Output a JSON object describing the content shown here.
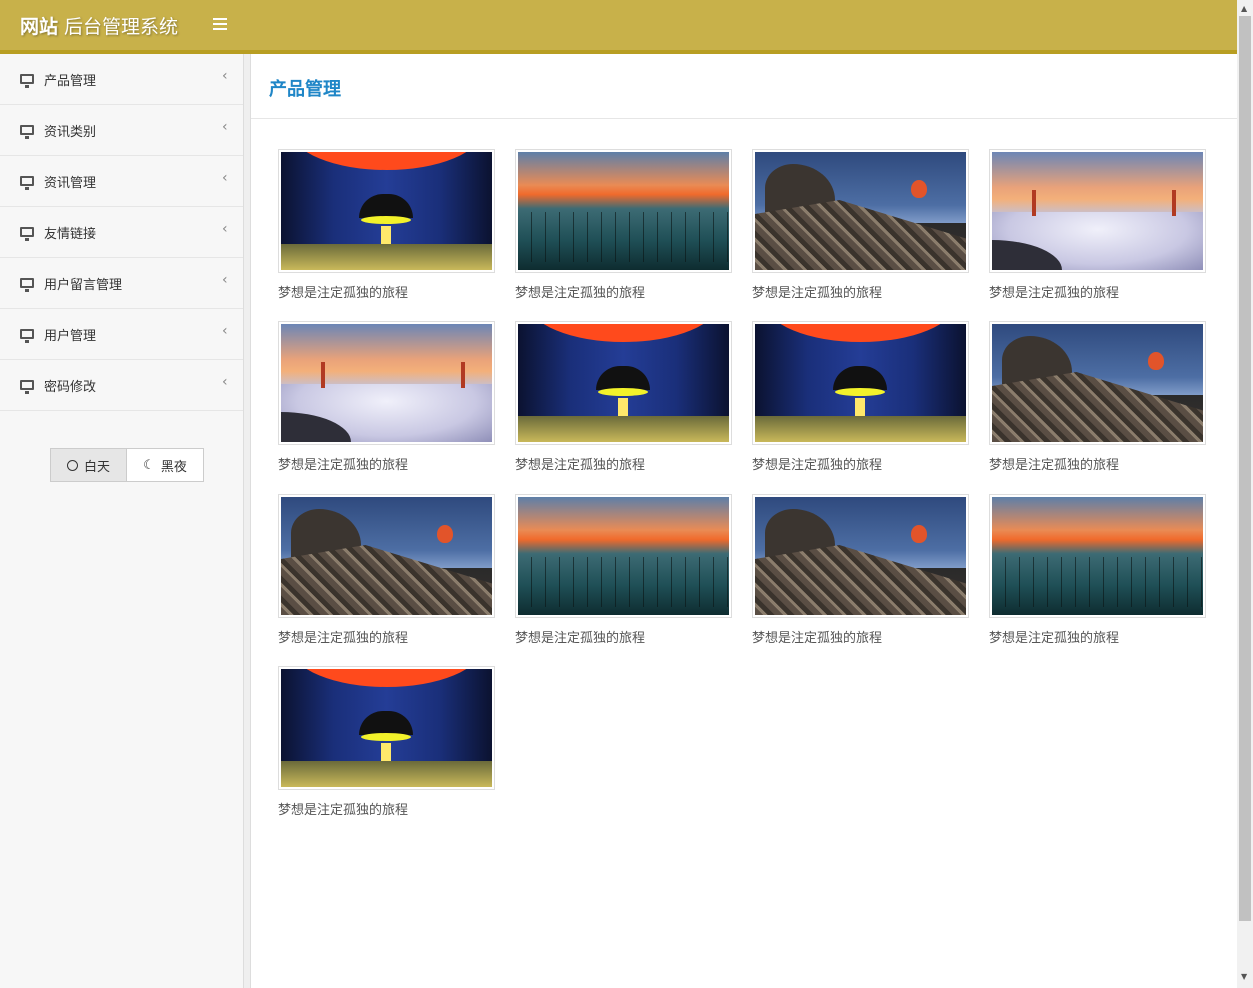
{
  "header": {
    "brand_main": "网站",
    "brand_sub": " 后台管理系统"
  },
  "sidebar": {
    "items": [
      {
        "label": "产品管理"
      },
      {
        "label": "资讯类别"
      },
      {
        "label": "资讯管理"
      },
      {
        "label": "友情链接"
      },
      {
        "label": "用户留言管理"
      },
      {
        "label": "用户管理"
      },
      {
        "label": "密码修改"
      }
    ],
    "theme": {
      "day_label": "白天",
      "night_label": "黑夜",
      "selected": "白天"
    }
  },
  "main": {
    "title": "产品管理",
    "products": [
      {
        "caption": "梦想是注定孤独的旅程",
        "image": "tunnel"
      },
      {
        "caption": "梦想是注定孤独的旅程",
        "image": "lake"
      },
      {
        "caption": "梦想是注定孤独的旅程",
        "image": "town"
      },
      {
        "caption": "梦想是注定孤独的旅程",
        "image": "bridge"
      },
      {
        "caption": "梦想是注定孤独的旅程",
        "image": "bridge"
      },
      {
        "caption": "梦想是注定孤独的旅程",
        "image": "tunnel"
      },
      {
        "caption": "梦想是注定孤独的旅程",
        "image": "tunnel"
      },
      {
        "caption": "梦想是注定孤独的旅程",
        "image": "town"
      },
      {
        "caption": "梦想是注定孤独的旅程",
        "image": "town"
      },
      {
        "caption": "梦想是注定孤独的旅程",
        "image": "lake"
      },
      {
        "caption": "梦想是注定孤独的旅程",
        "image": "town"
      },
      {
        "caption": "梦想是注定孤独的旅程",
        "image": "lake"
      },
      {
        "caption": "梦想是注定孤独的旅程",
        "image": "tunnel"
      }
    ]
  },
  "colors": {
    "header_bg": "#c8b14a",
    "header_border": "#b89e22",
    "title_blue": "#1f86c7"
  }
}
